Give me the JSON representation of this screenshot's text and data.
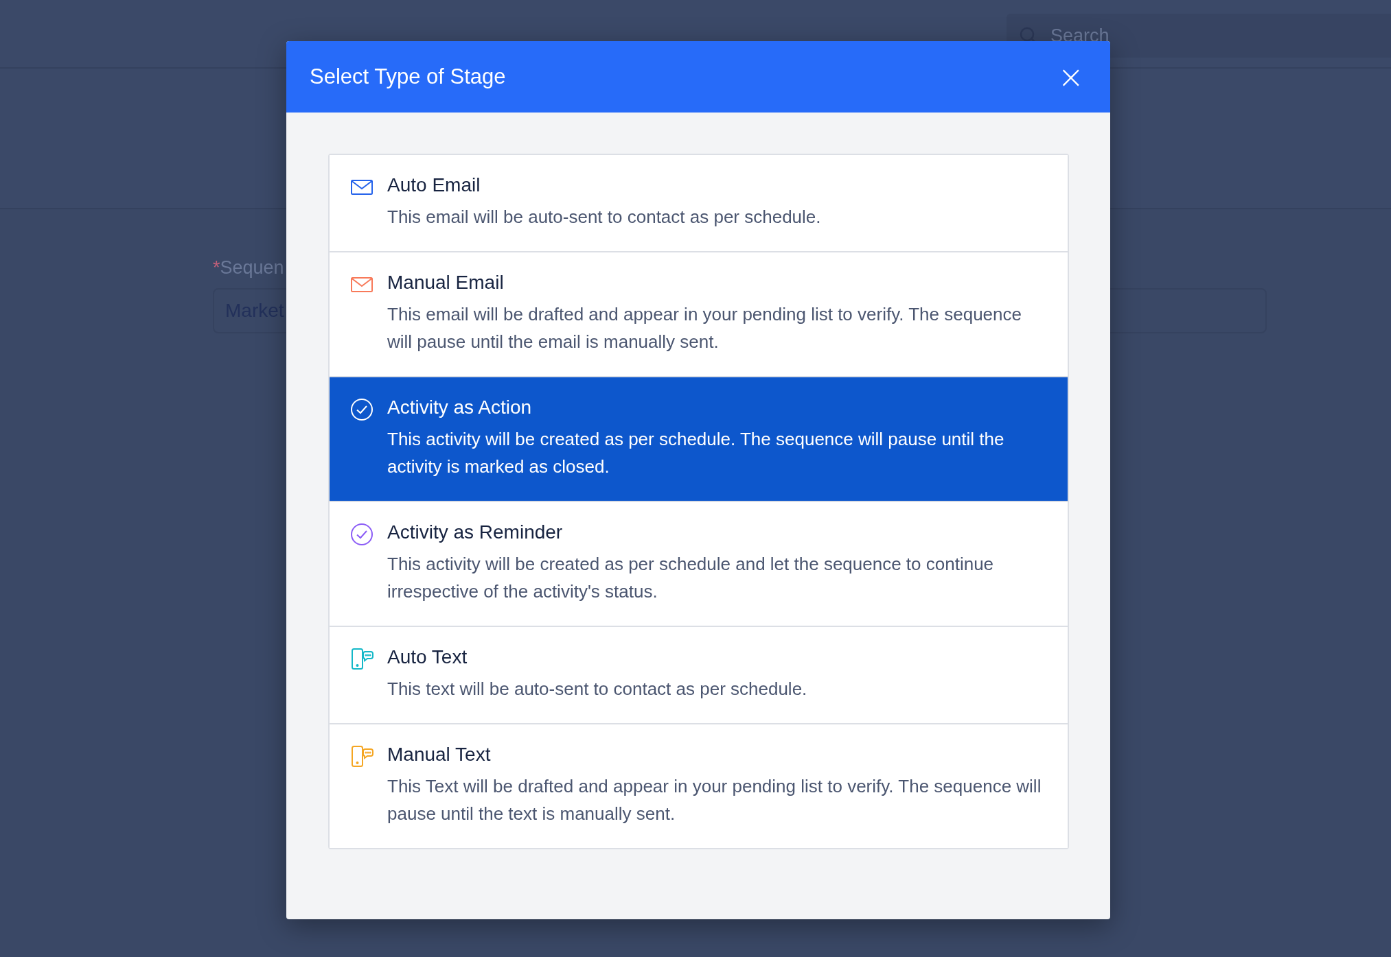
{
  "background": {
    "search": {
      "placeholder": "Search"
    },
    "field_label": {
      "required_mark": "*",
      "text": "Sequen"
    },
    "field_value": "Market"
  },
  "dialog": {
    "title": "Select Type of Stage",
    "close": "×",
    "options": [
      {
        "kind": "email",
        "color": "#2563eb",
        "title": "Auto Email",
        "description": "This email will be auto-sent to contact as per schedule.",
        "selected": false
      },
      {
        "kind": "email",
        "color": "#f87a5a",
        "title": "Manual Email",
        "description": "This email will be drafted and appear in your pending list to verify. The sequence will pause until the email is manually sent.",
        "selected": false
      },
      {
        "kind": "check",
        "color": "#ffffff",
        "title": "Activity as Action",
        "description": "This activity will be created as per schedule. The sequence will pause until the activity is marked as closed.",
        "selected": true
      },
      {
        "kind": "check",
        "color": "#8b5cf6",
        "title": "Activity as Reminder",
        "description": "This activity will be created as per schedule and let the sequence to continue irrespective of the activity's status.",
        "selected": false
      },
      {
        "kind": "text",
        "color": "#14b8c8",
        "title": "Auto Text",
        "description": "This text will be auto-sent to contact as per schedule.",
        "selected": false
      },
      {
        "kind": "text",
        "color": "#f5a623",
        "title": "Manual Text",
        "description": "This Text will be drafted and appear in your pending list to verify. The sequence will pause until the text is manually sent.",
        "selected": false
      }
    ]
  }
}
